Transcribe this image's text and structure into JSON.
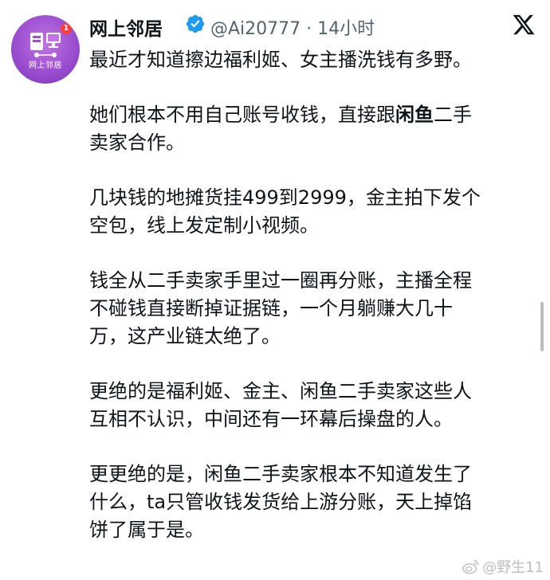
{
  "header": {
    "account_name": "网上邻居",
    "handle_time": "@Ai20777 · 14小时",
    "avatar_text": "网上邻居",
    "avatar_badge": "1"
  },
  "tweet": {
    "paragraphs": [
      {
        "lines": [
          "最近才知道擦边福利姬、女主播洗钱有多野。"
        ]
      },
      {
        "lines": [
          "她们根本不用自己账号收钱，直接跟闲鱼二手",
          "卖家合作。"
        ]
      },
      {
        "lines": [
          "几块钱的地摊货挂499到2999，金主拍下发个",
          "空包，线上发定制小视频。"
        ]
      },
      {
        "lines": [
          "钱全从二手卖家手里过一圈再分账，主播全程",
          "不碰钱直接断掉证据链，一个月躺赚大几十",
          "万，这产业链太绝了。"
        ]
      },
      {
        "lines": [
          "更绝的是福利姬、金主、闲鱼二手卖家这些人",
          "互相不认识，中间还有一环幕后操盘的人。"
        ]
      },
      {
        "lines": [
          "更更绝的是，闲鱼二手卖家根本不知道发生了",
          "什么，ta只管收钱发货给上游分账，天上掉馅",
          "饼了属于是。"
        ]
      }
    ],
    "p2_line1_pre": "她们根本不用自己账号收钱，直接跟",
    "p2_line1_bold": "闲鱼",
    "p2_line1_post": "二手"
  },
  "watermark": {
    "text": "@野生11"
  },
  "colors": {
    "verified": "#1d9bf0",
    "avatar": "#9b4fd0",
    "text": "#0f1419",
    "muted": "#536471"
  },
  "icons": {
    "verified": "verified-badge-icon",
    "platform": "x-logo-icon",
    "watermark": "weibo-logo-icon"
  }
}
